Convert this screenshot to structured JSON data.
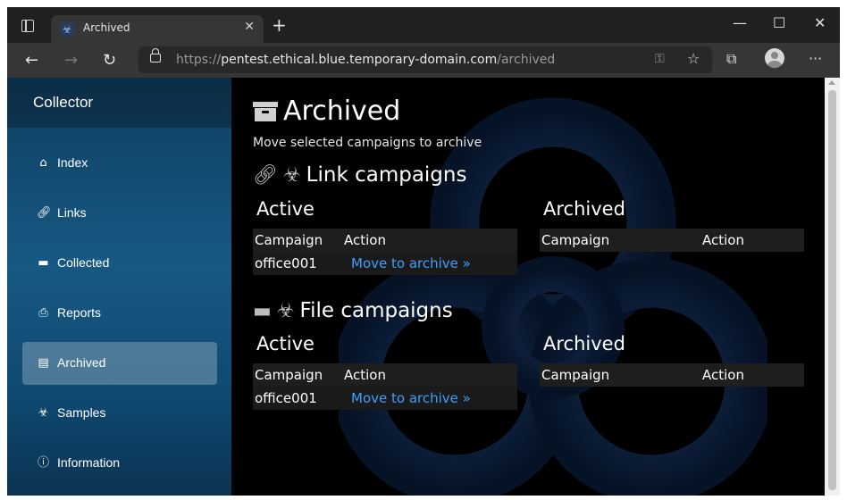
{
  "browser": {
    "tab_title": "Archived",
    "url_scheme": "https://",
    "url_host": "pentest.ethical.blue.temporary-domain.com",
    "url_path": "/archived"
  },
  "sidebar": {
    "brand": "Collector",
    "items": [
      {
        "label": "Index",
        "icon": "home-icon"
      },
      {
        "label": "Links",
        "icon": "link-icon"
      },
      {
        "label": "Collected",
        "icon": "folder-icon"
      },
      {
        "label": "Reports",
        "icon": "printer-icon"
      },
      {
        "label": "Archived",
        "icon": "archive-icon",
        "active": true
      },
      {
        "label": "Samples",
        "icon": "biohazard-icon"
      },
      {
        "label": "Information",
        "icon": "info-icon"
      }
    ]
  },
  "main": {
    "title": "Archived",
    "subtitle": "Move selected campaigns to archive",
    "link_section": {
      "title": "Link campaigns",
      "active_heading": "Active",
      "archived_heading": "Archived",
      "columns": [
        "Campaign",
        "Action"
      ],
      "active_rows": [
        {
          "campaign": "office001",
          "action": "Move to archive »"
        }
      ],
      "archived_rows": []
    },
    "file_section": {
      "title": "File campaigns",
      "active_heading": "Active",
      "archived_heading": "Archived",
      "columns": [
        "Campaign",
        "Action"
      ],
      "active_rows": [
        {
          "campaign": "office001",
          "action": "Move to archive »"
        }
      ],
      "archived_rows": []
    }
  },
  "colors": {
    "sidebar": "#175983",
    "link": "#3aa0ff",
    "background": "#000000"
  }
}
